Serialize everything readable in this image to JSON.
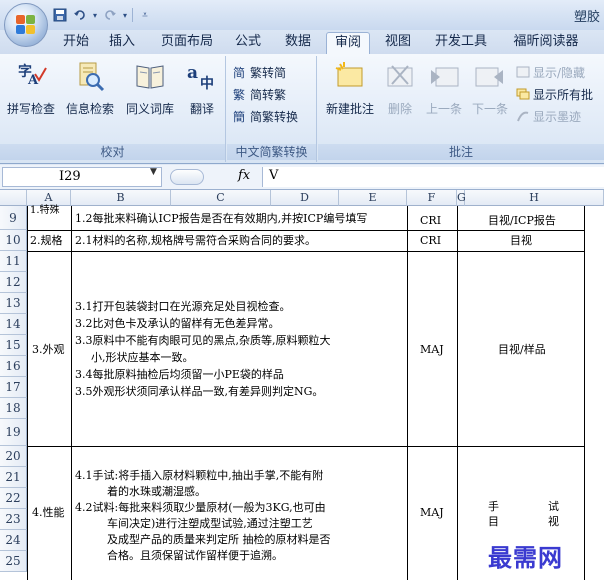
{
  "window": {
    "title": "塑胶",
    "qat": [
      "save-icon",
      "undo-icon",
      "redo-icon",
      "customize-icon"
    ]
  },
  "tabs": [
    "开始",
    "插入",
    "页面布局",
    "公式",
    "数据",
    "审阅",
    "视图",
    "开发工具",
    "福昕阅读器"
  ],
  "active_tab": "审阅",
  "ribbon": {
    "proofing": {
      "label": "校对",
      "buttons": [
        "拼写检查",
        "信息检索",
        "同义词库",
        "翻译"
      ]
    },
    "chinese_conversion": {
      "label": "中文简繁转换",
      "buttons": [
        "繁转简",
        "简转繁",
        "简繁转换"
      ]
    },
    "comments": {
      "label": "批注",
      "buttons": [
        "新建批注",
        "删除",
        "上一条",
        "下一条"
      ],
      "small_buttons": [
        "显示/隐藏",
        "显示所有批",
        "显示墨迹"
      ]
    }
  },
  "formula_bar": {
    "name_box": "I29",
    "fx": "fx",
    "value": "V"
  },
  "columns": [
    "A",
    "B",
    "C",
    "D",
    "E",
    "F",
    "G",
    "H"
  ],
  "rows": [
    "9",
    "10",
    "11",
    "12",
    "13",
    "14",
    "15",
    "16",
    "17",
    "18",
    "19",
    "20",
    "21",
    "22",
    "23",
    "24",
    "25"
  ],
  "table": {
    "r8_partial": "1.特殊",
    "r9": {
      "desc": "1.2每批来料确认ICP报告是否在有效期内,并按ICP编号填写",
      "level": "CRI",
      "method": "目视/ICP报告"
    },
    "r10": {
      "item": "2.规格",
      "desc": "2.1材料的名称,规格牌号需符合采购合同的要求。",
      "level": "CRI",
      "method": "目视"
    },
    "appearance": {
      "item": "3.外观",
      "lines": [
        "3.1打开包装袋封口在光源充足处目视检查。",
        "3.2比对色卡及承认的留样有无色差异常。",
        "3.3原料中不能有肉眼可见的黑点,杂质等,原料颗粒大",
        "小,形状应基本一致。",
        "3.4每批原料抽检后均须留一小PE袋的样品",
        "3.5外观形状须同承认样品一致,有差异则判定NG。"
      ],
      "level": "MAJ",
      "method": "目视/样品"
    },
    "performance": {
      "item": "4.性能",
      "lines": [
        "4.1手试:将手插入原材料颗粒中,抽出手掌,不能有附",
        "着的水珠或潮湿感。",
        "4.2试料:每批来料须取少量原材(一般为3KG,也可由",
        "车间决定)进行注塑成型试验,通过注塑工艺",
        "及成型产品的质量来判定所 抽检的原材料是否",
        "合格。且须保留试作留样便于追溯。"
      ],
      "level": "MAJ",
      "method_1a": "手",
      "method_1b": "试",
      "method_2a": "目",
      "method_2b": "视"
    }
  },
  "watermark": "最需网",
  "colors": {
    "ribbon_bg": "#e3ecf8",
    "accent": "#1e395b",
    "grid": "#000000",
    "watermark": "#3a3ad0"
  }
}
